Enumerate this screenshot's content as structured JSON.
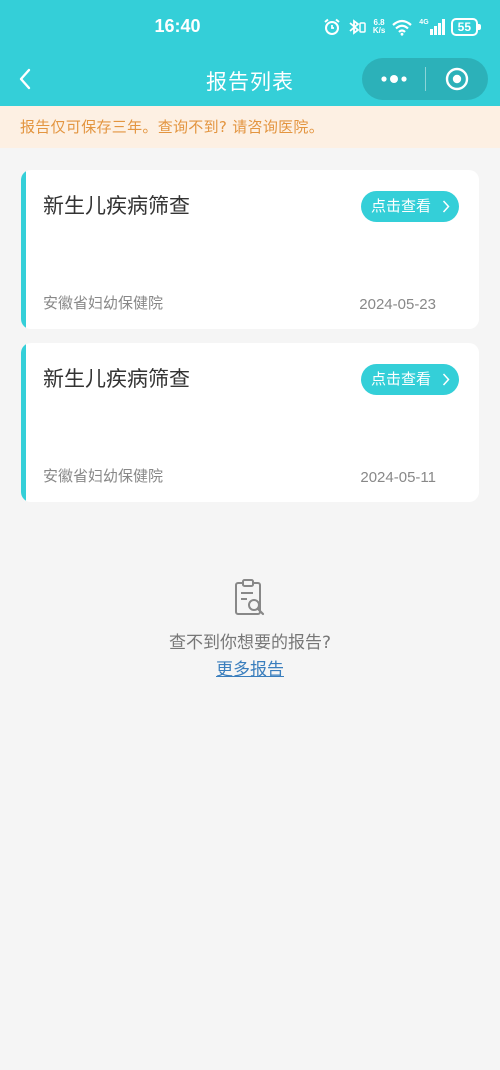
{
  "status": {
    "time": "16:40",
    "net_speed_top": "6.8",
    "net_speed_bottom": "K/s",
    "net_type": "4G",
    "battery": "55"
  },
  "navbar": {
    "title": "报告列表"
  },
  "notice": {
    "text": "报告仅可保存三年。查询不到? 请咨询医院。"
  },
  "reports": [
    {
      "title": "新生儿疾病筛查",
      "button": "点击查看",
      "hospital": "安徽省妇幼保健院",
      "date": "2024-05-23"
    },
    {
      "title": "新生儿疾病筛查",
      "button": "点击查看",
      "hospital": "安徽省妇幼保健院",
      "date": "2024-05-11"
    }
  ],
  "empty": {
    "text": "查不到你想要的报告?",
    "link": "更多报告"
  },
  "colors": {
    "primary": "#34cfd8",
    "notice_bg": "#fdf0e3",
    "notice_text": "#e39540",
    "link": "#3a7ebd"
  },
  "icons": [
    "back-arrow-icon",
    "more-dots-icon",
    "close-target-icon",
    "chevron-right-icon",
    "clipboard-search-icon",
    "alarm-icon",
    "bluetooth-icon",
    "wifi-icon",
    "signal-icon"
  ]
}
